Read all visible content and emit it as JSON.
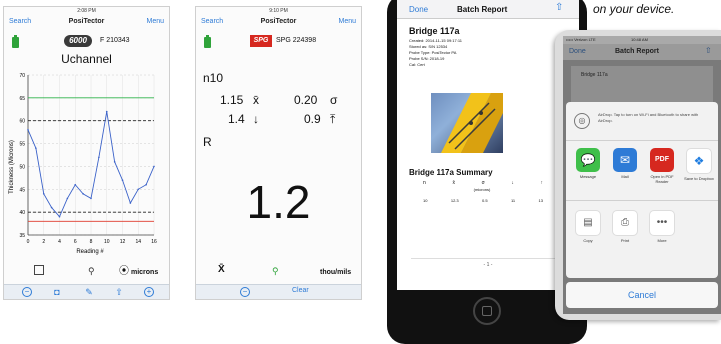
{
  "caption_fragment": "on your device.",
  "screen1": {
    "status_time": "2:08 PM",
    "nav_left": "Search",
    "nav_title": "PosiTector",
    "nav_right": "Menu",
    "probe_badge": "6000",
    "serial": "F 210343",
    "chart_title": "Uchannel",
    "footer_unit": "microns"
  },
  "screen2": {
    "status_time": "9:10 PM",
    "nav_left": "Search",
    "nav_title": "PosiTector",
    "nav_right": "Menu",
    "probe_badge": "SPG",
    "serial": "SPG 224398",
    "n_label": "n10",
    "mean_value": "1.15",
    "mean_symbol": "x̄",
    "sigma_value": "0.20",
    "sigma_symbol": "σ",
    "min_value": "1.4",
    "min_symbol": "↓",
    "max_value": "0.9",
    "max_symbol": "⤒",
    "r_label": "R",
    "big_reading": "1.2",
    "footer_left": "X̄",
    "footer_right": "thou/mils",
    "clear_label": "Clear"
  },
  "screen3": {
    "nav_done": "Done",
    "nav_title": "Batch Report",
    "batch_title": "Bridge 117a",
    "meta_lines": [
      "Created: 2014-11-15 09:17:11",
      "Stored as: S/N 12534",
      "Probe Type: PosiTector PA",
      "Probe S/N: 2018-19",
      "Cal: Cert"
    ],
    "summary_title": "Bridge 117a Summary",
    "summary_headers": [
      "n",
      "x̄",
      "σ",
      "↓",
      "↑"
    ],
    "summary_unit": "(microns)",
    "summary_values": [
      "10",
      "12.3",
      "0.5",
      "11",
      "13"
    ],
    "footer_mark": "- 1 -"
  },
  "screen4": {
    "status_left": "••••• Verizon LTE",
    "status_time": "10:48 AM",
    "nav_done": "Done",
    "nav_title": "Batch Report",
    "doc_title": "Bridge 117a",
    "airdrop_text": "AirDrop. Tap to turn on Wi-Fi and Bluetooth to share with AirDrop.",
    "share_apps": [
      {
        "name": "message",
        "label": "Message"
      },
      {
        "name": "mail",
        "label": "Mail"
      },
      {
        "name": "pdf",
        "label": "Open in PDF Reader"
      },
      {
        "name": "dropbox",
        "label": "Save to Dropbox"
      }
    ],
    "pdf_badge_text": "PDF",
    "actions": [
      {
        "name": "copy",
        "label": "Copy"
      },
      {
        "name": "print",
        "label": "Print"
      },
      {
        "name": "more",
        "label": "More"
      }
    ],
    "cancel_label": "Cancel"
  },
  "chart_data": {
    "type": "line",
    "title": "Uchannel",
    "xlabel": "Reading #",
    "ylabel": "Thickness (Microns)",
    "xlim": [
      0,
      16
    ],
    "ylim": [
      35,
      70
    ],
    "xticks": [
      0,
      2,
      4,
      6,
      8,
      10,
      12,
      14,
      16
    ],
    "yticks": [
      35,
      40,
      45,
      50,
      55,
      60,
      65,
      70
    ],
    "x": [
      0,
      1,
      2,
      3,
      4,
      5,
      6,
      7,
      8,
      9,
      10,
      11,
      12,
      13,
      14,
      15,
      16
    ],
    "series": [
      {
        "values": [
          58,
          54,
          44,
          41,
          39,
          43,
          46,
          44,
          43,
          52,
          62,
          51,
          47,
          42,
          45,
          46,
          50
        ],
        "color": "#3b62c9"
      }
    ],
    "reference_lines": [
      {
        "y": 65,
        "color": "#2db24a"
      },
      {
        "y": 60,
        "color": "#222222"
      },
      {
        "y": 40,
        "color": "#222222"
      },
      {
        "y": 38,
        "color": "#e03b2c"
      }
    ]
  }
}
